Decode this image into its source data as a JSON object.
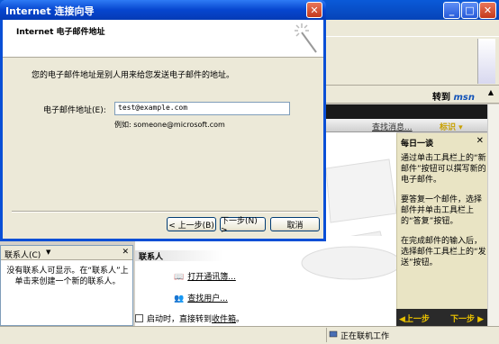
{
  "wizard": {
    "title": "Internet 连接向导",
    "header_title": "Internet 电子邮件地址",
    "description": "您的电子邮件地址是别人用来给您发送电子邮件的地址。",
    "field_label": "电子邮件地址(E):",
    "email_value": "test@example.com",
    "example_text": "例如: someone@microsoft.com",
    "back_label": "< 上一步(B)",
    "next_label": "下一步(N) >",
    "cancel_label": "取消"
  },
  "outlook": {
    "goto_label": "转到",
    "msn_label": "msn",
    "find_messages": "查找消息...",
    "tags_label": "标识 ▾",
    "tips": {
      "title": "每日一谈",
      "paragraphs": [
        "通过单击工具栏上的“新邮件”按钮可以撰写新的电子邮件。",
        "要答复一个邮件，选择邮件并单击工具栏上的“答复”按钮。",
        "在完成邮件的输入后，选择邮件工具栏上的“发送”按钮。"
      ],
      "prev_label": "◀上一步",
      "next_label": "下一步 ▶"
    },
    "contacts_pane": {
      "label": "联系人(C)",
      "message": "没有联系人可显示。在“联系人”上单击来创建一个新的联系人。"
    },
    "contacts_section": {
      "title": "联系人",
      "open_addressbook": "打开通讯簿...",
      "find_people": "查找用户...",
      "startup_prefix": "启动时，直接转到",
      "startup_link": "收件箱",
      "startup_suffix": "。"
    },
    "status": "正在联机工作"
  },
  "colors": {
    "titlebar": "#0646cf",
    "tips_bg": "#e9e4c4",
    "tips_nav_text": "#e8c000"
  }
}
